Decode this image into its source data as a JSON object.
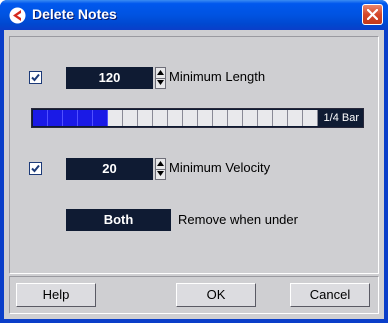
{
  "window": {
    "title": "Delete Notes",
    "app_icon": "cubase-icon",
    "close_icon": "close-icon"
  },
  "min_length": {
    "checked": true,
    "value": "120",
    "label": "Minimum Length",
    "bar_readout": "1/4 Bar",
    "bar_filled_cells": 5,
    "bar_total_cells": 19
  },
  "min_velocity": {
    "checked": true,
    "value": "20",
    "label": "Minimum Velocity"
  },
  "remove_when_under": {
    "value": "Both",
    "label": "Remove when under"
  },
  "buttons": {
    "help": "Help",
    "ok": "OK",
    "cancel": "Cancel"
  },
  "colors": {
    "titlebar": "#0054e3",
    "bar_filled": "#1a1ae6",
    "field_bg": "#0f1b33",
    "dialog_bg": "#cfcfd2"
  }
}
